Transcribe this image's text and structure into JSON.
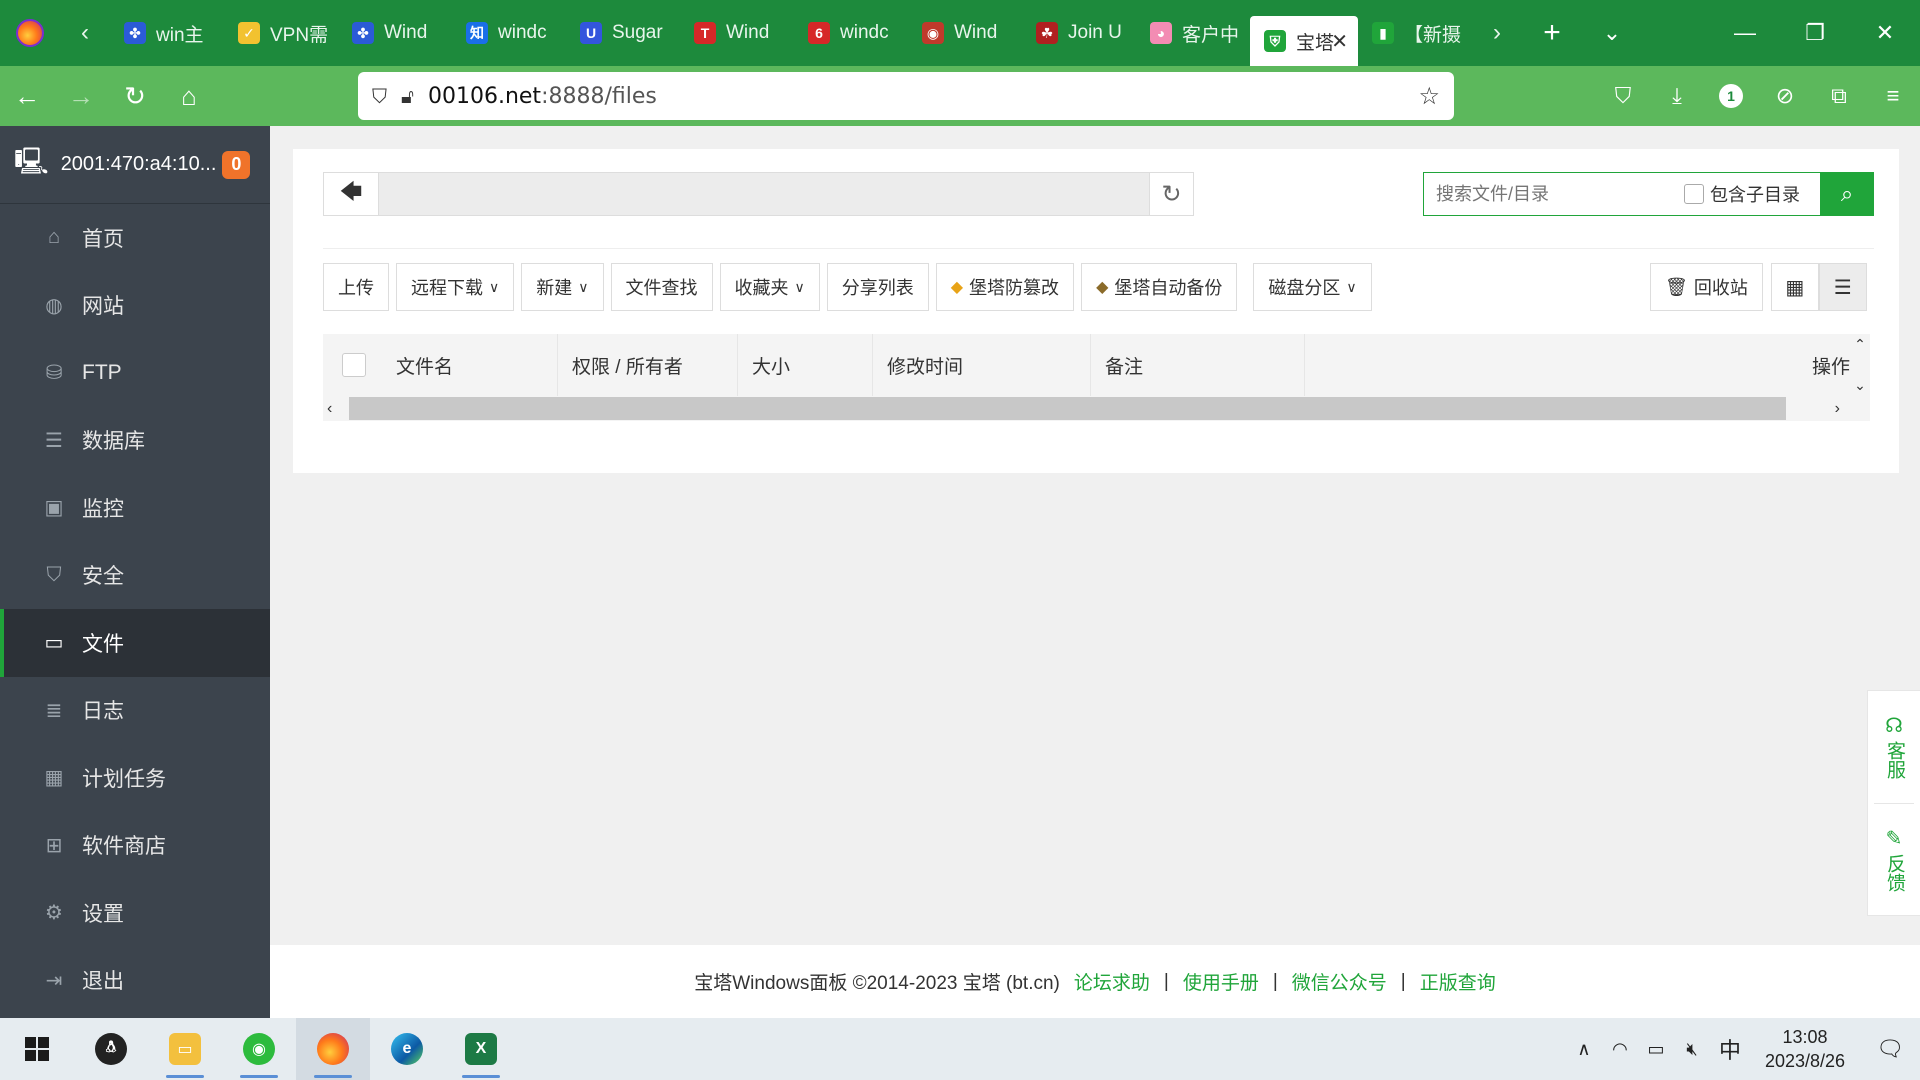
{
  "browser": {
    "tabs": [
      {
        "title": "win主",
        "icon_color": "#2b5bd7",
        "glyph": "✤"
      },
      {
        "title": "VPN需",
        "icon_color": "#f2c230",
        "glyph": "✓"
      },
      {
        "title": "Wind",
        "icon_color": "#2b5bd7",
        "glyph": "✤"
      },
      {
        "title": "windc",
        "icon_color": "#1a6fe8",
        "glyph": "知"
      },
      {
        "title": "Sugar",
        "icon_color": "#3355dd",
        "glyph": "U"
      },
      {
        "title": "Wind",
        "icon_color": "#d62828",
        "glyph": "T"
      },
      {
        "title": "windc",
        "icon_color": "#d62828",
        "glyph": "6"
      },
      {
        "title": "Wind",
        "icon_color": "#c0392b",
        "glyph": "◉"
      },
      {
        "title": "Join U",
        "icon_color": "#b02020",
        "glyph": "☘"
      },
      {
        "title": "客户中",
        "icon_color": "#f38cb3",
        "glyph": "◕"
      },
      {
        "title": "宝塔",
        "icon_color": "#20a53a",
        "glyph": "⛨",
        "active": true
      },
      {
        "title": "【新摄",
        "icon_color": "#20a53a",
        "glyph": "▮"
      }
    ],
    "url_host": "00106.net",
    "url_port_path": ":8888/files",
    "update_badge": "1"
  },
  "sidebar": {
    "server_ip": "2001:470:a4:10...",
    "alert_count": "0",
    "items": [
      {
        "label": "首页",
        "icon": "home-icon",
        "glyph": "⌂"
      },
      {
        "label": "网站",
        "icon": "globe-icon",
        "glyph": "◍"
      },
      {
        "label": "FTP",
        "icon": "ftp-icon",
        "glyph": "⛁"
      },
      {
        "label": "数据库",
        "icon": "database-icon",
        "glyph": "☰"
      },
      {
        "label": "监控",
        "icon": "monitor-icon",
        "glyph": "▣"
      },
      {
        "label": "安全",
        "icon": "shield-icon",
        "glyph": "⛉"
      },
      {
        "label": "文件",
        "icon": "folder-icon",
        "glyph": "▭",
        "active": true
      },
      {
        "label": "日志",
        "icon": "log-icon",
        "glyph": "≣"
      },
      {
        "label": "计划任务",
        "icon": "calendar-icon",
        "glyph": "▦"
      },
      {
        "label": "软件商店",
        "icon": "apps-icon",
        "glyph": "⊞"
      },
      {
        "label": "设置",
        "icon": "gear-icon",
        "glyph": "⚙"
      },
      {
        "label": "退出",
        "icon": "logout-icon",
        "glyph": "⇥"
      }
    ]
  },
  "files": {
    "search_placeholder": "搜索文件/目录",
    "include_subdir": "包含子目录",
    "toolbar": {
      "upload": "上传",
      "remote_download": "远程下载",
      "new": "新建",
      "file_search": "文件查找",
      "favorites": "收藏夹",
      "share_list": "分享列表",
      "tamper_proof": "堡塔防篡改",
      "auto_backup": "堡塔自动备份",
      "disk_partition": "磁盘分区",
      "recycle_bin": "回收站"
    },
    "columns": {
      "name": "文件名",
      "perm_owner": "权限 / 所有者",
      "size": "大小",
      "mtime": "修改时间",
      "remark": "备注",
      "ops": "操作"
    }
  },
  "footer": {
    "copyright": "宝塔Windows面板 ©2014-2023 宝塔 (bt.cn)",
    "forum": "论坛求助",
    "manual": "使用手册",
    "wechat": "微信公众号",
    "license": "正版查询",
    "separator": "|"
  },
  "float_service": {
    "service": "客服",
    "feedback": "反馈"
  },
  "taskbar": {
    "ime": "中",
    "time": "13:08",
    "date": "2023/8/26"
  },
  "colors": {
    "brand_green": "#20a53a",
    "browser_tab_bg": "#1d8a3c",
    "browser_nav_bg": "#5cb85c",
    "sidebar_bg": "#3c444d",
    "alert_orange": "#f0732a"
  }
}
